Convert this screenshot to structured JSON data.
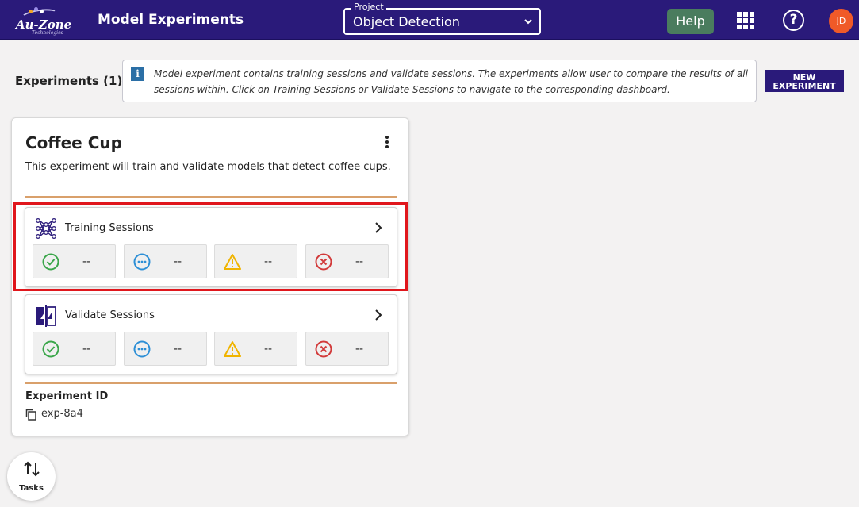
{
  "header": {
    "logo_text": "Au-Zone",
    "logo_sub": "Technologies",
    "app_title": "Model Experiments",
    "project_legend": "Project",
    "project_value": "Object Detection",
    "help_label": "Help",
    "avatar_initials": "JD",
    "help_icon_glyph": "?"
  },
  "page": {
    "heading": "Experiments (1)",
    "info_icon_glyph": "i",
    "info_text": "Model experiment contains training sessions and validate sessions. The experiments allow user to compare the results of all sessions within. Click on Training Sessions or Validate Sessions to navigate to the corresponding dashboard.",
    "new_experiment_line1": "NEW",
    "new_experiment_line2": "EXPERIMENT"
  },
  "experiment": {
    "title": "Coffee Cup",
    "description": "This experiment will train and validate models that detect coffee cups.",
    "id_label": "Experiment ID",
    "id_value": "exp-8a4",
    "training": {
      "label": "Training Sessions",
      "stats": [
        {
          "icon": "check-circle-icon",
          "value": "--"
        },
        {
          "icon": "ellipsis-circle-icon",
          "value": "--"
        },
        {
          "icon": "warning-triangle-icon",
          "value": "--"
        },
        {
          "icon": "error-circle-icon",
          "value": "--"
        }
      ]
    },
    "validate": {
      "label": "Validate Sessions",
      "stats": [
        {
          "icon": "check-circle-icon",
          "value": "--"
        },
        {
          "icon": "ellipsis-circle-icon",
          "value": "--"
        },
        {
          "icon": "warning-triangle-icon",
          "value": "--"
        },
        {
          "icon": "error-circle-icon",
          "value": "--"
        }
      ]
    }
  },
  "tasks": {
    "label": "Tasks"
  },
  "colors": {
    "topbar": "#2a1a7a",
    "help_button": "#4a7c5e",
    "avatar": "#f05a28",
    "divider": "#d9a06b",
    "highlight": "#e0161c",
    "success": "#3aa64a",
    "running": "#2d8fd6",
    "warning": "#f0b400",
    "error": "#d23a3a"
  }
}
